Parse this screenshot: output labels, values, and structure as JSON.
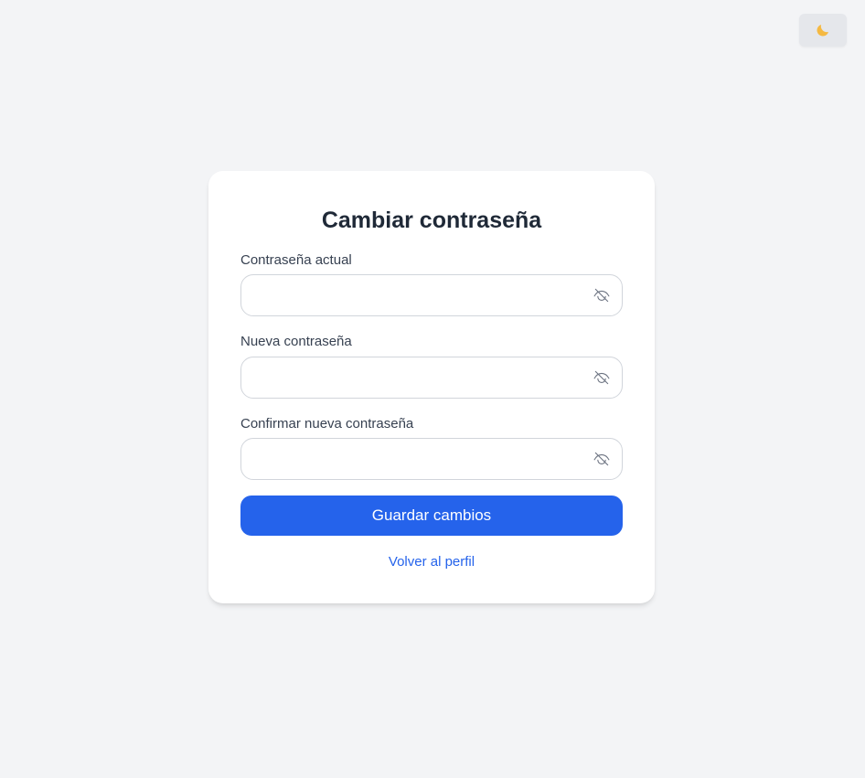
{
  "theme_toggle": {
    "icon": "moon-icon",
    "glyph": "🌙",
    "color": "#f5b942"
  },
  "form": {
    "title": "Cambiar contraseña",
    "fields": [
      {
        "label": "Contraseña actual",
        "value": "",
        "placeholder": "",
        "toggle_icon": "eye-slash-icon"
      },
      {
        "label": "Nueva contraseña",
        "value": "",
        "placeholder": "",
        "toggle_icon": "eye-slash-icon"
      },
      {
        "label": "Confirmar nueva contraseña",
        "value": "",
        "placeholder": "",
        "toggle_icon": "eye-slash-icon"
      }
    ],
    "submit_label": "Guardar cambios",
    "back_link_label": "Volver al perfil"
  },
  "colors": {
    "background": "#f3f4f6",
    "card": "#ffffff",
    "accent": "#2563eb",
    "title_text": "#1f2937",
    "label_text": "#374151",
    "input_border": "#d1d5db"
  }
}
